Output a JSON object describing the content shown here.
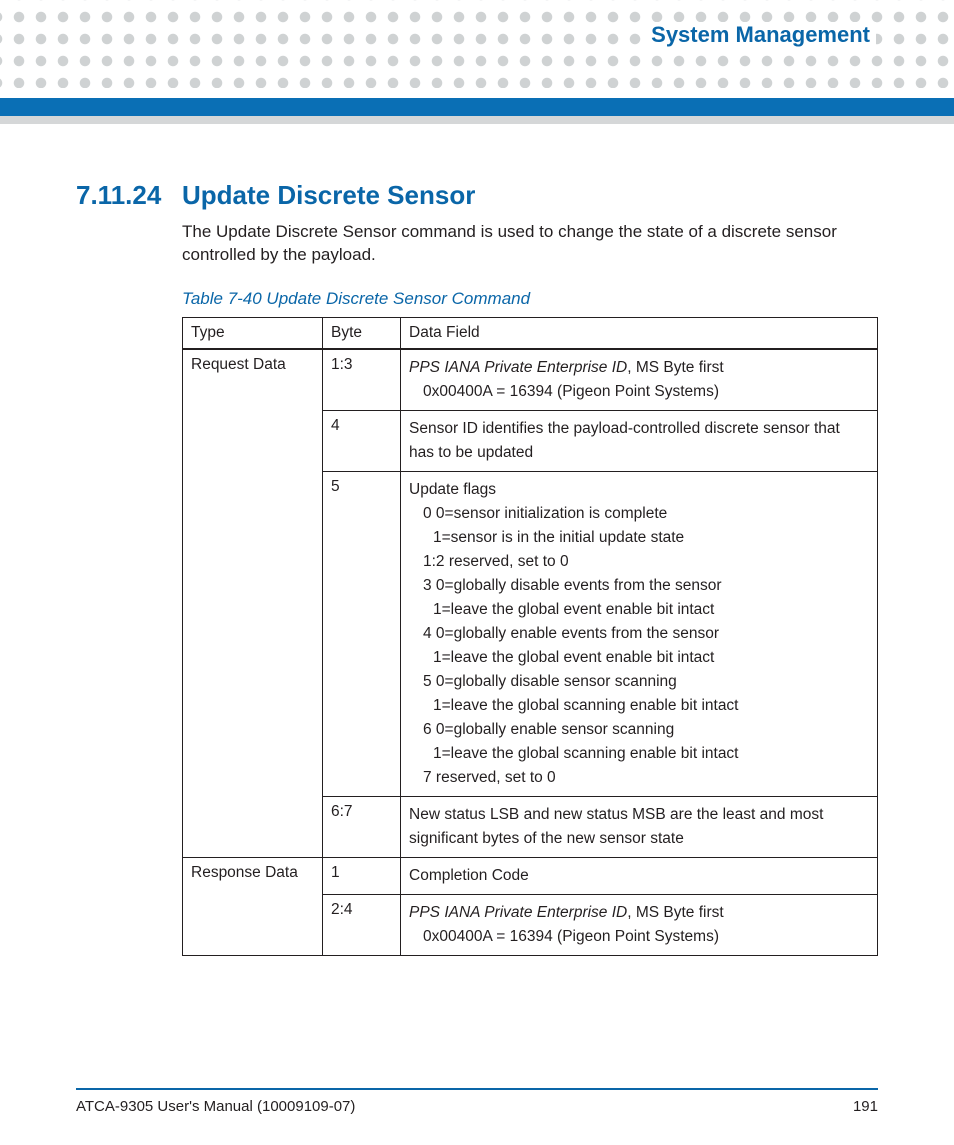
{
  "header": {
    "title": "System Management"
  },
  "section": {
    "number": "7.11.24",
    "title": "Update Discrete Sensor",
    "intro": "The Update Discrete Sensor command is used to change the state of a discrete sensor controlled by the payload."
  },
  "table": {
    "caption": "Table 7-40 Update Discrete Sensor Command",
    "headers": {
      "type": "Type",
      "byte": "Byte",
      "data_field": "Data Field"
    },
    "request_label": "Request Data",
    "response_label": "Response Data",
    "request": [
      {
        "byte": "1:3",
        "lines": [
          {
            "cls": "df-line",
            "html": "<span class=\"it\">PPS IANA Private Enterprise ID</span>, MS Byte first"
          },
          {
            "cls": "df-line indent1",
            "text": "0x00400A = 16394 (Pigeon Point Systems)"
          }
        ]
      },
      {
        "byte": "4",
        "lines": [
          {
            "cls": "df-line",
            "text": "Sensor ID identifies the payload-controlled discrete sensor that has to be updated"
          }
        ]
      },
      {
        "byte": "5",
        "lines": [
          {
            "cls": "df-line",
            "text": "Update flags"
          },
          {
            "cls": "df-line indent1",
            "text": "0 0=sensor initialization is complete"
          },
          {
            "cls": "df-line indent2",
            "text": "1=sensor is in the initial update state"
          },
          {
            "cls": "df-line indent1",
            "text": "1:2 reserved, set to 0"
          },
          {
            "cls": "df-line indent1",
            "text": "3 0=globally disable events from the sensor"
          },
          {
            "cls": "df-line indent2",
            "text": "1=leave the global event enable bit intact"
          },
          {
            "cls": "df-line indent1",
            "text": "4 0=globally enable events from the sensor"
          },
          {
            "cls": "df-line indent2",
            "text": "1=leave the global event enable bit intact"
          },
          {
            "cls": "df-line indent1",
            "text": "5 0=globally disable sensor scanning"
          },
          {
            "cls": "df-line indent2",
            "text": "1=leave the global scanning enable bit intact"
          },
          {
            "cls": "df-line indent1",
            "text": "6 0=globally enable sensor scanning"
          },
          {
            "cls": "df-line indent2",
            "text": "1=leave the global scanning enable bit intact"
          },
          {
            "cls": "df-line indent1",
            "text": "7 reserved, set to 0"
          }
        ]
      },
      {
        "byte": "6:7",
        "lines": [
          {
            "cls": "df-line",
            "text": "New status LSB and new status MSB are the least and most significant bytes of the new sensor state"
          }
        ]
      }
    ],
    "response": [
      {
        "byte": "1",
        "lines": [
          {
            "cls": "df-line",
            "text": "Completion Code"
          }
        ]
      },
      {
        "byte": "2:4",
        "lines": [
          {
            "cls": "df-line",
            "html": "<span class=\"it\">PPS IANA Private Enterprise ID</span>, MS Byte first"
          },
          {
            "cls": "df-line indent1",
            "text": "0x00400A = 16394 (Pigeon Point Systems)"
          }
        ]
      }
    ]
  },
  "footer": {
    "manual": "ATCA-9305 User's Manual (10009109-07)",
    "page": "191"
  }
}
